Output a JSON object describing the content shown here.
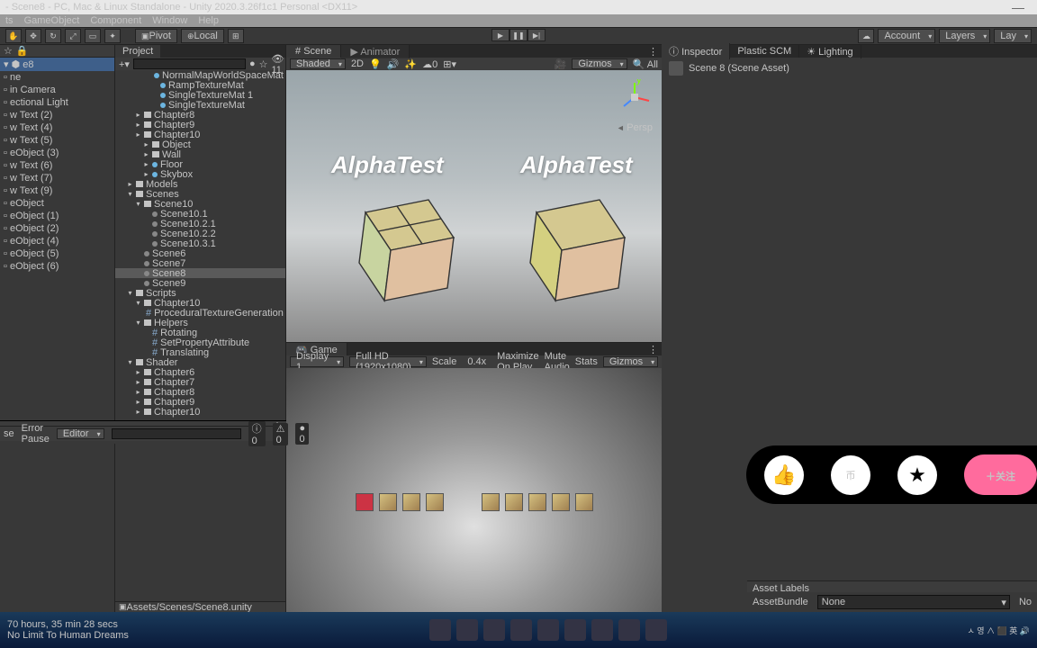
{
  "window": {
    "title": "- Scene8 - PC, Mac & Linux Standalone - Unity 2020.3.26f1c1 Personal <DX11>"
  },
  "menu": {
    "items": [
      "ts",
      "GameObject",
      "Component",
      "Window",
      "Help"
    ]
  },
  "toolbar": {
    "pivot": "Pivot",
    "local": "Local",
    "account": "Account",
    "layers": "Layers",
    "layout": "Lay"
  },
  "hierarchy": {
    "items": [
      "e8",
      "ne",
      "in Camera",
      "ectional Light",
      "w Text (2)",
      "w Text (4)",
      "w Text (5)",
      "eObject (3)",
      "w Text (6)",
      "w Text (7)",
      "w Text (9)",
      "eObject",
      "eObject (1)",
      "eObject (2)",
      "eObject (4)",
      "eObject (5)",
      "eObject (6)"
    ]
  },
  "project": {
    "tab": "Project",
    "mats": [
      "NormalMapWorldSpaceMat",
      "RampTextureMat",
      "SingleTextureMat 1",
      "SingleTextureMat"
    ],
    "folders1": [
      "Chapter8",
      "Chapter9",
      "Chapter10",
      "Object",
      "Wall",
      "Floor",
      "Skybox"
    ],
    "models": "Models",
    "scenes": "Scenes",
    "scene10": "Scene10",
    "subscenes": [
      "Scene10.1",
      "Scene10.2.1",
      "Scene10.2.2",
      "Scene10.3.1"
    ],
    "scenes2": [
      "Scene6",
      "Scene7",
      "Scene8",
      "Scene9"
    ],
    "scripts": "Scripts",
    "chapter10": "Chapter10",
    "proc": "ProceduralTextureGeneration",
    "helpers": "Helpers",
    "helperScripts": [
      "Rotating",
      "SetPropertyAttribute",
      "Translating"
    ],
    "shader": "Shader",
    "shaderFolders": [
      "Chapter6",
      "Chapter7",
      "Chapter8",
      "Chapter9",
      "Chapter10"
    ],
    "path": "Assets/Scenes/Scene8.unity"
  },
  "scene": {
    "tab1": "Scene",
    "tab2": "Animator",
    "shading": "Shaded",
    "mode2d": "2D",
    "gizmos": "Gizmos",
    "all": "All",
    "label": "AlphaTest",
    "persp": "Persp"
  },
  "game": {
    "tab": "Game",
    "display": "Display 1",
    "res": "Full HD (1920x1080)",
    "scale": "Scale",
    "scaleVal": "0.4x",
    "maxplay": "Maximize On Play",
    "mute": "Mute Audio",
    "stats": "Stats",
    "gizmos": "Gizmos"
  },
  "console": {
    "se": "se",
    "errpause": "Error Pause",
    "editor": "Editor",
    "c0": "0",
    "c1": "0",
    "c2": "0"
  },
  "inspector": {
    "tabs": [
      "Inspector",
      "Plastic SCM",
      "Lighting"
    ],
    "sceneAsset": "Scene 8 (Scene Asset)",
    "assetLabels": "Asset Labels",
    "assetBundle": "AssetBundle",
    "none": "None",
    "no": "No"
  },
  "overlay": {
    "follow": "＋关注",
    "coin": "币"
  },
  "taskbar": {
    "hours": "70 hours, 35 min 28 secs",
    "dreams": "No Limit To Human Dreams"
  }
}
